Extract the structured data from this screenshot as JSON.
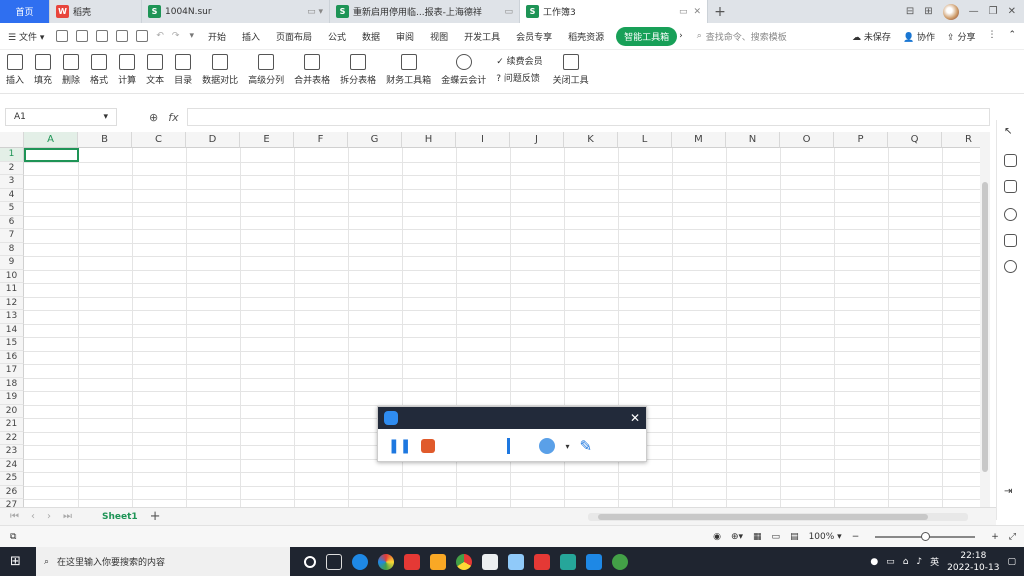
{
  "tabs": {
    "home": "首页",
    "items": [
      {
        "label": "稻壳",
        "color": "#e8453c",
        "glyph": "W"
      },
      {
        "label": "1004N.sur",
        "color": "#1e9456",
        "glyph": "S"
      },
      {
        "label": "重新启用停用临...报表-上海德祥",
        "color": "#1e9456",
        "glyph": "S"
      },
      {
        "label": "工作簿3",
        "color": "#1e9456",
        "glyph": "S"
      }
    ],
    "add": "+"
  },
  "menu": {
    "file": "文件",
    "items": [
      "开始",
      "插入",
      "页面布局",
      "公式",
      "数据",
      "审阅",
      "视图",
      "开发工具",
      "会员专享",
      "稻壳资源"
    ],
    "smart_tools": "智能工具箱",
    "search_placeholder": "查找命令、搜索模板",
    "unsaved": "未保存",
    "collab": "协作",
    "share": "分享"
  },
  "ribbon": {
    "big": [
      "插入",
      "填充",
      "删除",
      "格式",
      "计算",
      "文本",
      "目录",
      "数据对比",
      "高级分列",
      "合并表格",
      "拆分表格",
      "财务工具箱",
      "金蝶云会计"
    ],
    "small": [
      "续费会员",
      "问题反馈"
    ],
    "close": "关闭工具"
  },
  "formula": {
    "cell_ref": "A1",
    "fx": "fx"
  },
  "columns": [
    "A",
    "B",
    "C",
    "D",
    "E",
    "F",
    "G",
    "H",
    "I",
    "J",
    "K",
    "L",
    "M",
    "N",
    "O",
    "P",
    "Q",
    "R"
  ],
  "rows": [
    "1",
    "2",
    "3",
    "4",
    "5",
    "6",
    "7",
    "8",
    "9",
    "10",
    "11",
    "12",
    "13",
    "14",
    "15",
    "16",
    "17",
    "18",
    "19",
    "20",
    "21",
    "22",
    "23",
    "24",
    "25",
    "26",
    "27"
  ],
  "sheet": {
    "name": "Sheet1",
    "add": "+"
  },
  "status": {
    "zoom": "100%"
  },
  "taskbar": {
    "search_placeholder": "在这里输入你要搜索的内容",
    "time": "22:18",
    "date": "2022-10-13",
    "lang": "英"
  },
  "colors": {
    "accent": "#1e9456",
    "home_tab": "#2f6ff0",
    "taskbar": "#1f2530"
  }
}
